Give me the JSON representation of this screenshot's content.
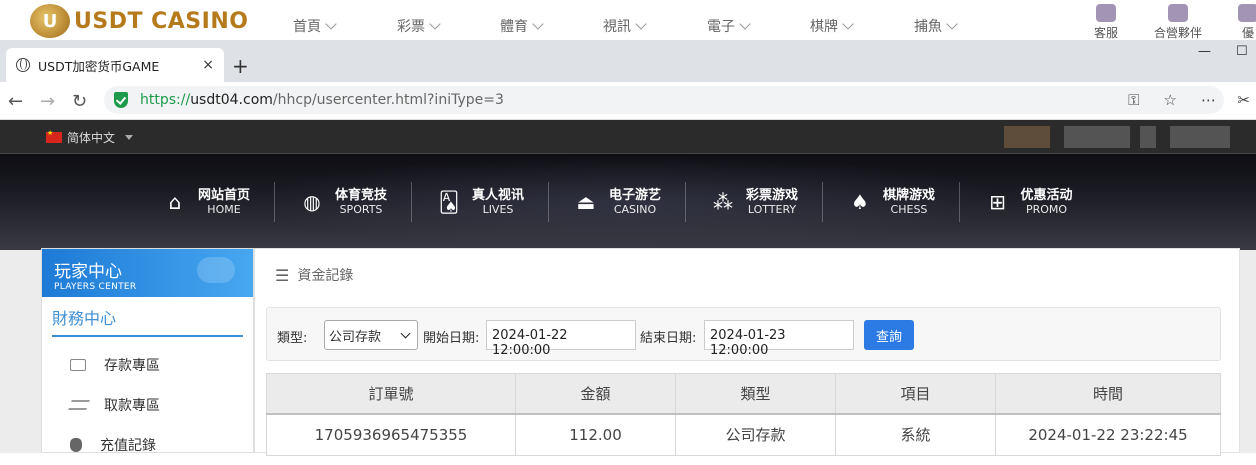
{
  "site": {
    "logo_text": "USDT CASINO",
    "logo_badge": "U",
    "top_nav": [
      {
        "label": "首頁"
      },
      {
        "label": "彩票"
      },
      {
        "label": "體育"
      },
      {
        "label": "視訊"
      },
      {
        "label": "電子"
      },
      {
        "label": "棋牌"
      },
      {
        "label": "捕魚"
      }
    ],
    "top_right": [
      {
        "label": "客服"
      },
      {
        "label": "合營夥伴"
      },
      {
        "label": "優"
      }
    ]
  },
  "browser": {
    "tab_title": "USDT加密货币GAME",
    "tab_close": "×",
    "new_tab": "+",
    "url_proto": "https://",
    "url_host": "usdt04.com",
    "url_path": "/hhcp/usercenter.html?iniType=3",
    "minimize": "—",
    "maximize": "☐"
  },
  "lang_bar": {
    "language": "简体中文"
  },
  "main_nav": [
    {
      "cn": "网站首页",
      "en": "HOME",
      "icon": "home-icon"
    },
    {
      "cn": "体育竞技",
      "en": "SPORTS",
      "icon": "ball-icon"
    },
    {
      "cn": "真人视讯",
      "en": "LIVES",
      "icon": "cards-icon"
    },
    {
      "cn": "电子游艺",
      "en": "CASINO",
      "icon": "joystick-icon"
    },
    {
      "cn": "彩票游戏",
      "en": "LOTTERY",
      "icon": "lottery-balls-icon"
    },
    {
      "cn": "棋牌游戏",
      "en": "CHESS",
      "icon": "spade-icon"
    },
    {
      "cn": "优惠活动",
      "en": "PROMO",
      "icon": "gift-icon"
    }
  ],
  "sidebar": {
    "header_cn": "玩家中心",
    "header_en": "PLAYERS CENTER",
    "section_title": "財務中心",
    "items": [
      {
        "label": "存款專區"
      },
      {
        "label": "取款專區"
      },
      {
        "label": "充值記錄"
      }
    ]
  },
  "panel": {
    "title": "資金記錄",
    "filter": {
      "type_label": "類型:",
      "type_value": "公司存款",
      "start_label": "開始日期:",
      "start_value": "2024-01-22 12:00:00",
      "end_label": "結束日期:",
      "end_value": "2024-01-23 12:00:00",
      "search_label": "查詢"
    },
    "table": {
      "headers": [
        "訂單號",
        "金額",
        "類型",
        "項目",
        "時間"
      ],
      "rows": [
        [
          "1705936965475355",
          "112.00",
          "公司存款",
          "系統",
          "2024-01-22 23:22:45"
        ]
      ]
    }
  }
}
